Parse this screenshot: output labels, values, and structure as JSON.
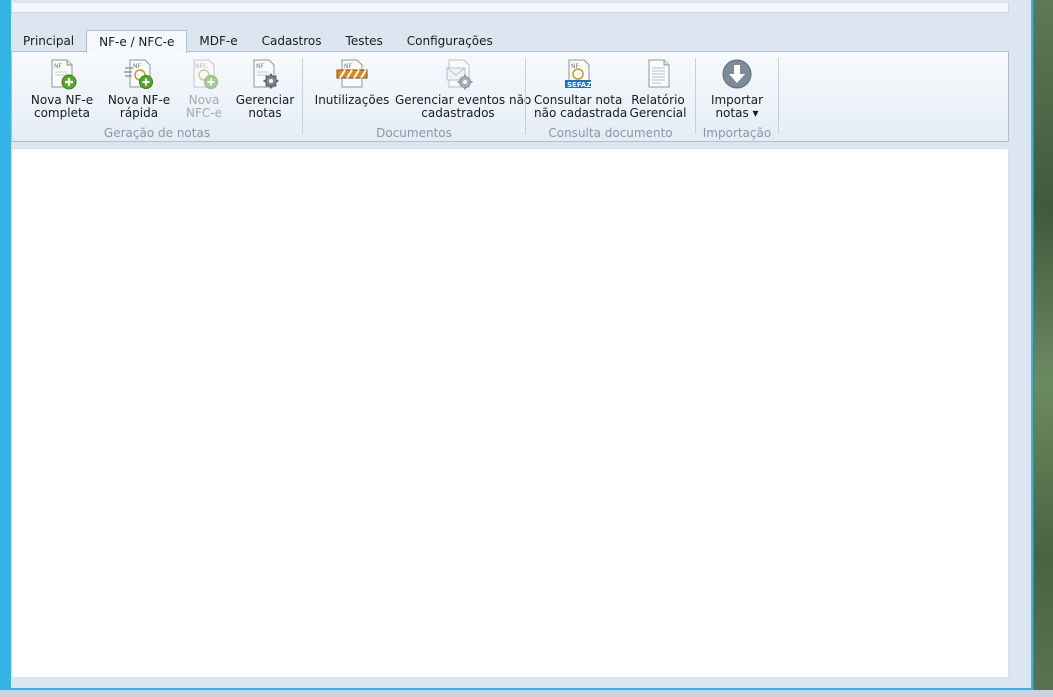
{
  "tabs": [
    {
      "label": "Principal",
      "active": false
    },
    {
      "label": "NF-e / NFC-e",
      "active": true
    },
    {
      "label": "MDF-e",
      "active": false
    },
    {
      "label": "Cadastros",
      "active": false
    },
    {
      "label": "Testes",
      "active": false
    },
    {
      "label": "Configurações",
      "active": false
    }
  ],
  "ribbon": {
    "groups": [
      {
        "caption": "Geração de notas",
        "buttons": [
          {
            "line1": "Nova NF-e",
            "line2": "completa",
            "icon": "nf-add-icon",
            "enabled": true
          },
          {
            "line1": "Nova NF-e",
            "line2": "rápida",
            "icon": "nf-quick-add-icon",
            "enabled": true
          },
          {
            "line1": "Nova",
            "line2": "NFC-e",
            "icon": "nfc-add-icon",
            "enabled": false
          },
          {
            "line1": "Gerenciar",
            "line2": "notas",
            "icon": "nf-gear-icon",
            "enabled": true
          }
        ]
      },
      {
        "caption": "Documentos",
        "buttons": [
          {
            "line1": "Inutilizações",
            "line2": "",
            "icon": "nf-barrier-icon",
            "enabled": true
          },
          {
            "line1": "Gerenciar eventos não",
            "line2": "cadastrados",
            "icon": "envelope-gear-icon",
            "enabled": true
          }
        ]
      },
      {
        "caption": "Consulta documento",
        "buttons": [
          {
            "line1": "Consultar nota",
            "line2": "não cadastrada",
            "icon": "sefaz-search-icon",
            "enabled": true
          },
          {
            "line1": "Relatório",
            "line2": "Gerencial",
            "icon": "report-icon",
            "enabled": true
          }
        ]
      },
      {
        "caption": "Importação",
        "buttons": [
          {
            "line1": "Importar",
            "line2": "notas ▾",
            "icon": "download-arrow-icon",
            "enabled": true
          }
        ]
      }
    ]
  },
  "colors": {
    "window_frame": "#34b4e6",
    "ribbon_bg": "#eaf1f8",
    "caption_text": "#8a97a6",
    "disabled_text": "#a2aab3"
  }
}
